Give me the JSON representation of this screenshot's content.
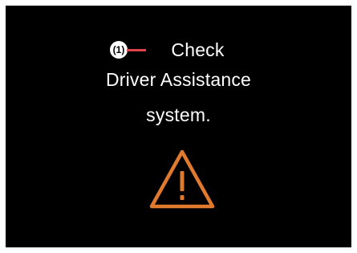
{
  "message": {
    "line1": "Check",
    "line2": "Driver Assistance",
    "line3": "system."
  },
  "callout": {
    "number": "(1)"
  },
  "icons": {
    "warning": "warning-triangle-icon"
  },
  "colors": {
    "background": "#000000",
    "text": "#ffffff",
    "warning": "#e07a2e",
    "callout_line": "#e0424a"
  }
}
